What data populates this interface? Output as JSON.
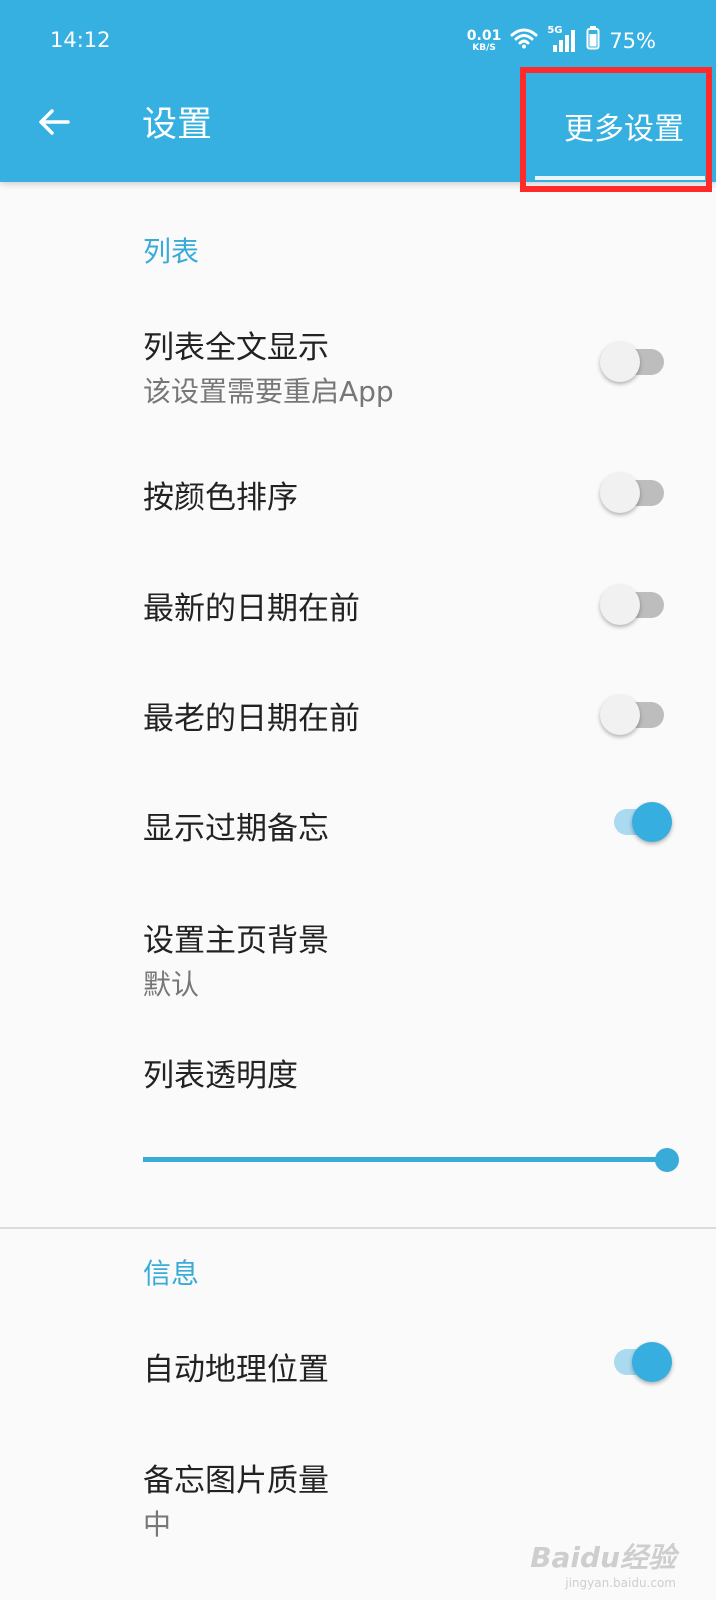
{
  "status_bar": {
    "time": "14:12",
    "net_speed_value": "0.01",
    "net_speed_unit": "KB/S",
    "network_type": "5G",
    "battery": "75%",
    "icons": [
      "wifi-icon",
      "signal-icon",
      "battery-icon"
    ]
  },
  "app_bar": {
    "back_icon": "arrow-left-icon",
    "title": "设置",
    "more_button": "更多设置",
    "color": "#36b0e1"
  },
  "sections": {
    "list": {
      "header": "列表",
      "items": [
        {
          "title": "列表全文显示",
          "subtitle": "该设置需要重启App",
          "switch_on": false
        },
        {
          "title": "按颜色排序",
          "switch_on": false
        },
        {
          "title": "最新的日期在前",
          "switch_on": false
        },
        {
          "title": "最老的日期在前",
          "switch_on": false
        },
        {
          "title": "显示过期备忘",
          "switch_on": true
        },
        {
          "title": "设置主页背景",
          "subtitle": "默认"
        },
        {
          "title": "列表透明度",
          "slider_value": 1.0
        }
      ]
    },
    "info": {
      "header": "信息",
      "items": [
        {
          "title": "自动地理位置",
          "switch_on": true
        },
        {
          "title": "备忘图片质量",
          "subtitle": "中"
        }
      ]
    }
  },
  "accent_color": "#39abd8",
  "watermark": {
    "brand": "Baidu经验",
    "site": "jingyan.baidu.com"
  }
}
